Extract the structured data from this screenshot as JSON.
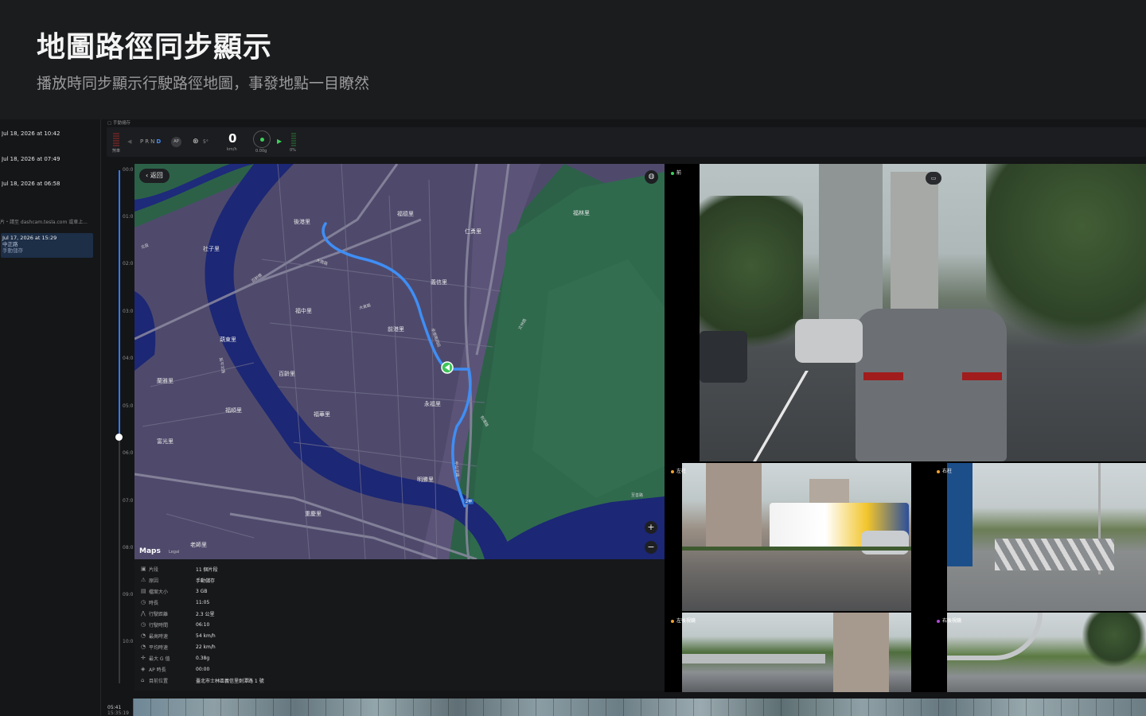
{
  "hero": {
    "title": "地圖路徑同步顯示",
    "subtitle": "播放時同步顯示行駛路徑地圖，事發地點一目瞭然"
  },
  "sidebar": {
    "items": [
      {
        "label": "Jul 18, 2026 at 10:42"
      },
      {
        "label": "Jul 18, 2026 at 07:49"
      },
      {
        "label": "Jul 18, 2026 at 06:58"
      }
    ],
    "hint": "片・請至 dashcam.tesla.com 或車上...",
    "active": {
      "label": "Jul 17, 2026 at 15:29",
      "location": "中正路",
      "reason": "手動儲存"
    }
  },
  "toolbar": {
    "event_label": "手動儲存"
  },
  "telemetry": {
    "brake_label": "煞車",
    "gears": [
      "P",
      "R",
      "N",
      "D"
    ],
    "active_gear": "D",
    "ap_badge": "AP",
    "steering": "5°",
    "speed": "0",
    "speed_unit": "km/h",
    "g_force": "0.00g",
    "throttle": "0%"
  },
  "timeline": {
    "ticks": [
      "00:0",
      "01:0",
      "02:0",
      "03:0",
      "04:0",
      "05:0",
      "06:0",
      "07:0",
      "08:0",
      "09:0",
      "10:0"
    ],
    "progress": 0.52
  },
  "map": {
    "back_label": "返回",
    "logo": "Maps",
    "legal": "Legal",
    "zoom_in": "+",
    "zoom_out": "−",
    "places": [
      "福德里",
      "福林里",
      "後港里",
      "仁勇里",
      "社子里",
      "義信里",
      "福中里",
      "前港里",
      "前港里",
      "葫東里",
      "百齡里",
      "蘭雅里",
      "福順里",
      "福華里",
      "永福里",
      "富光里",
      "明勝里",
      "重慶里",
      "老師里"
    ],
    "streets": [
      "百齡橋",
      "中山北路",
      "承德路四段",
      "大南路",
      "大東路",
      "文林路",
      "延平北路",
      "劍潭路",
      "北投",
      "至善路"
    ],
    "road_shield": "2甲"
  },
  "info": {
    "rows": [
      {
        "icon": "clips-icon",
        "key": "片段",
        "value": "11 個片段"
      },
      {
        "icon": "reason-icon",
        "key": "原因",
        "value": "手動儲存"
      },
      {
        "icon": "size-icon",
        "key": "檔案大小",
        "value": "3 GB"
      },
      {
        "icon": "clock-icon",
        "key": "時長",
        "value": "11:05"
      },
      {
        "icon": "distance-icon",
        "key": "行駛距離",
        "value": "2.3 公里"
      },
      {
        "icon": "drive-time-icon",
        "key": "行駛時間",
        "value": "06:10"
      },
      {
        "icon": "max-speed-icon",
        "key": "最高時速",
        "value": "54 km/h"
      },
      {
        "icon": "avg-speed-icon",
        "key": "平均時速",
        "value": "22 km/h"
      },
      {
        "icon": "gforce-icon",
        "key": "最大 G 值",
        "value": "0.38g"
      },
      {
        "icon": "ap-icon",
        "key": "AP 時長",
        "value": "00:00"
      },
      {
        "icon": "location-icon",
        "key": "目前位置",
        "value": "臺北市士林區義信里劍潭路 1 號"
      }
    ]
  },
  "cameras": {
    "front": "前",
    "left_pillar": "左柱",
    "right_pillar": "右柱",
    "left_repeater": "左後視鏡",
    "right_repeater": "右後視鏡"
  },
  "bottom": {
    "time1": "05:41",
    "time2": "15:35:19"
  }
}
